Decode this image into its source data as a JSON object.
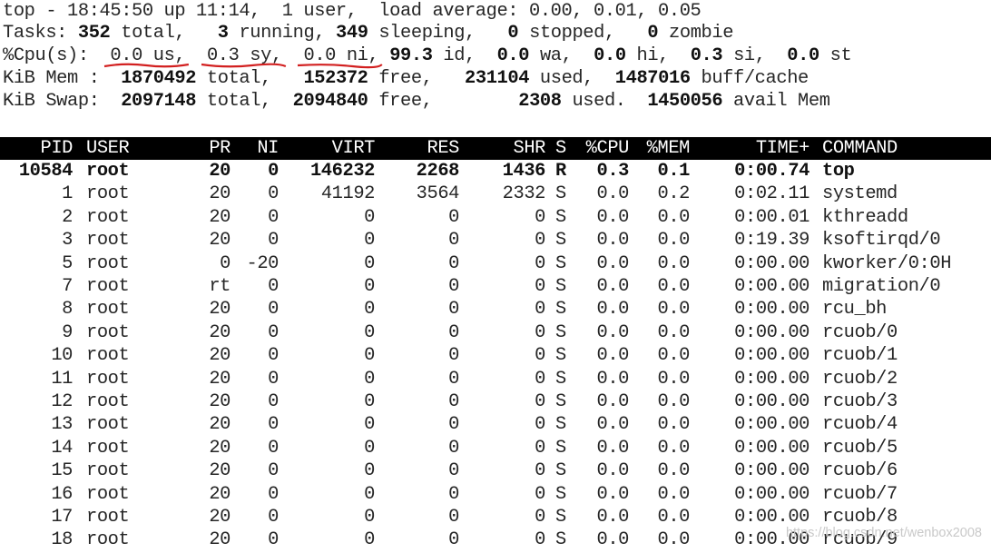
{
  "summary": {
    "line1": "top - 18:45:50 up 11:14,  1 user,  load average: 0.00, 0.01, 0.05",
    "tasks": {
      "label": "Tasks:",
      "total": "352",
      "total_label": "total,",
      "running": "3",
      "running_label": "running,",
      "sleeping": "349",
      "sleeping_label": "sleeping,",
      "stopped": "0",
      "stopped_label": "stopped,",
      "zombie": "0",
      "zombie_label": "zombie"
    },
    "cpu": {
      "label": "%Cpu(s):",
      "us": "0.0 us,",
      "sy": "0.3 sy,",
      "ni": "0.0 ni,",
      "id": "99.3",
      "id_label": "id,",
      "wa": "0.0",
      "wa_label": "wa,",
      "hi": "0.0",
      "hi_label": "hi,",
      "si": "0.3",
      "si_label": "si,",
      "st": "0.0",
      "st_label": "st",
      "underline_color": "#d21f1f"
    },
    "mem": {
      "label": "KiB Mem :",
      "total": "1870492",
      "total_label": "total,",
      "free": "152372",
      "free_label": "free,",
      "used": "231104",
      "used_label": "used,",
      "buff": "1487016",
      "buff_label": "buff/cache"
    },
    "swap": {
      "label": "KiB Swap:",
      "total": "2097148",
      "total_label": "total,",
      "free": "2094840",
      "free_label": "free,",
      "used": "2308",
      "used_label": "used.",
      "avail": "1450056",
      "avail_label": "avail Mem"
    }
  },
  "table": {
    "columns": [
      "PID",
      "USER",
      "PR",
      "NI",
      "VIRT",
      "RES",
      "SHR",
      "S",
      "%CPU",
      "%MEM",
      "TIME+",
      "COMMAND"
    ],
    "rows": [
      [
        "10584",
        "root",
        "20",
        "0",
        "146232",
        "2268",
        "1436",
        "R",
        "0.3",
        "0.1",
        "0:00.74",
        "top"
      ],
      [
        "1",
        "root",
        "20",
        "0",
        "41192",
        "3564",
        "2332",
        "S",
        "0.0",
        "0.2",
        "0:02.11",
        "systemd"
      ],
      [
        "2",
        "root",
        "20",
        "0",
        "0",
        "0",
        "0",
        "S",
        "0.0",
        "0.0",
        "0:00.01",
        "kthreadd"
      ],
      [
        "3",
        "root",
        "20",
        "0",
        "0",
        "0",
        "0",
        "S",
        "0.0",
        "0.0",
        "0:19.39",
        "ksoftirqd/0"
      ],
      [
        "5",
        "root",
        "0",
        "-20",
        "0",
        "0",
        "0",
        "S",
        "0.0",
        "0.0",
        "0:00.00",
        "kworker/0:0H"
      ],
      [
        "7",
        "root",
        "rt",
        "0",
        "0",
        "0",
        "0",
        "S",
        "0.0",
        "0.0",
        "0:00.00",
        "migration/0"
      ],
      [
        "8",
        "root",
        "20",
        "0",
        "0",
        "0",
        "0",
        "S",
        "0.0",
        "0.0",
        "0:00.00",
        "rcu_bh"
      ],
      [
        "9",
        "root",
        "20",
        "0",
        "0",
        "0",
        "0",
        "S",
        "0.0",
        "0.0",
        "0:00.00",
        "rcuob/0"
      ],
      [
        "10",
        "root",
        "20",
        "0",
        "0",
        "0",
        "0",
        "S",
        "0.0",
        "0.0",
        "0:00.00",
        "rcuob/1"
      ],
      [
        "11",
        "root",
        "20",
        "0",
        "0",
        "0",
        "0",
        "S",
        "0.0",
        "0.0",
        "0:00.00",
        "rcuob/2"
      ],
      [
        "12",
        "root",
        "20",
        "0",
        "0",
        "0",
        "0",
        "S",
        "0.0",
        "0.0",
        "0:00.00",
        "rcuob/3"
      ],
      [
        "13",
        "root",
        "20",
        "0",
        "0",
        "0",
        "0",
        "S",
        "0.0",
        "0.0",
        "0:00.00",
        "rcuob/4"
      ],
      [
        "14",
        "root",
        "20",
        "0",
        "0",
        "0",
        "0",
        "S",
        "0.0",
        "0.0",
        "0:00.00",
        "rcuob/5"
      ],
      [
        "15",
        "root",
        "20",
        "0",
        "0",
        "0",
        "0",
        "S",
        "0.0",
        "0.0",
        "0:00.00",
        "rcuob/6"
      ],
      [
        "16",
        "root",
        "20",
        "0",
        "0",
        "0",
        "0",
        "S",
        "0.0",
        "0.0",
        "0:00.00",
        "rcuob/7"
      ],
      [
        "17",
        "root",
        "20",
        "0",
        "0",
        "0",
        "0",
        "S",
        "0.0",
        "0.0",
        "0:00.00",
        "rcuob/8"
      ],
      [
        "18",
        "root",
        "20",
        "0",
        "0",
        "0",
        "0",
        "S",
        "0.0",
        "0.0",
        "0:00.00",
        "rcuob/9"
      ]
    ],
    "bold_row_index": 0
  },
  "watermark": "https://blog.csdn.net/wenbox2008"
}
